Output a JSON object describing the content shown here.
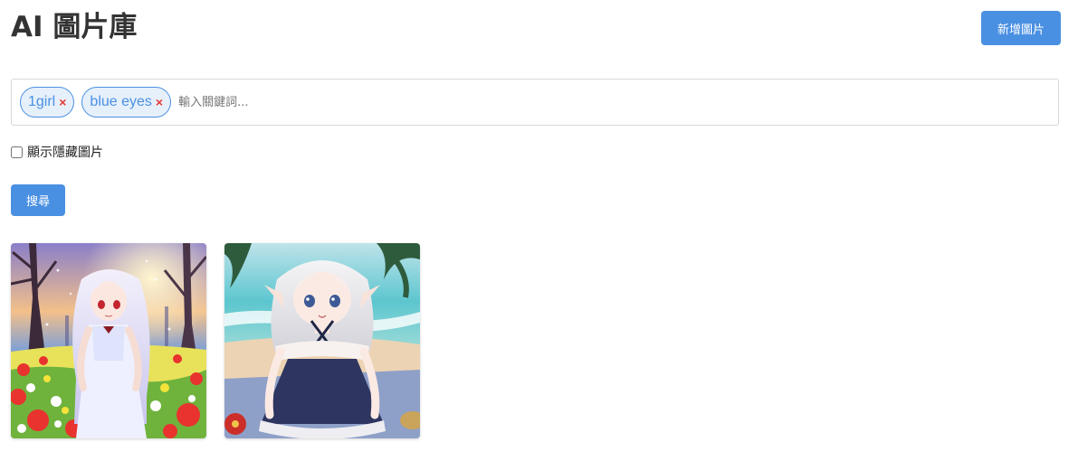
{
  "app": {
    "title": "AI 圖片庫",
    "add_button_label": "新增圖片"
  },
  "search": {
    "tags": [
      {
        "label": "1girl",
        "remove_icon": "×"
      },
      {
        "label": "blue eyes",
        "remove_icon": "×"
      }
    ],
    "input_value": "",
    "input_placeholder": "輸入關鍵詞...",
    "show_hidden_label": "顯示隱藏圖片",
    "show_hidden_checked": false,
    "search_button_label": "搜尋"
  },
  "gallery": {
    "images": [
      {
        "subject": "anime girl with long white hair in a flower field at sunset"
      },
      {
        "subject": "anime elf girl with white hair sitting on a beach"
      }
    ]
  },
  "colors": {
    "accent": "#4a90e2",
    "tag_background": "#e6f0fb",
    "tag_remove": "#e53935",
    "heading": "#333333"
  }
}
